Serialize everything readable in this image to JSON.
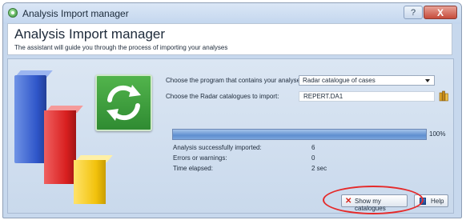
{
  "window": {
    "title": "Analysis Import manager",
    "help_glyph": "?",
    "close_glyph": "X"
  },
  "header": {
    "title": "Analysis Import manager",
    "subtitle": "The assistant will guide you through the process of importing your analyses"
  },
  "form": {
    "program_label": "Choose the program that contains your analyses:",
    "program_value": "Radar catalogue of cases",
    "catalogues_label": "Choose the Radar catalogues to import:",
    "catalogues_value": "REPERT.DA1"
  },
  "progress": {
    "percent": 100,
    "percent_text": "100%"
  },
  "stats": {
    "imported_label": "Analysis successfully imported:",
    "imported_value": "6",
    "errors_label": "Errors or warnings:",
    "errors_value": "0",
    "time_label": "Time elapsed:",
    "time_value": "2 sec"
  },
  "buttons": {
    "show_catalogues": "Show my catalogues",
    "help": "Help"
  },
  "icons": {
    "app": "app-icon",
    "refresh": "refresh-icon",
    "books": "books-icon",
    "x_mark": "x-icon",
    "help": "help-book-icon"
  },
  "colors": {
    "highlight": "#e52a2a",
    "refresh_tile": "#3c9c3a"
  }
}
